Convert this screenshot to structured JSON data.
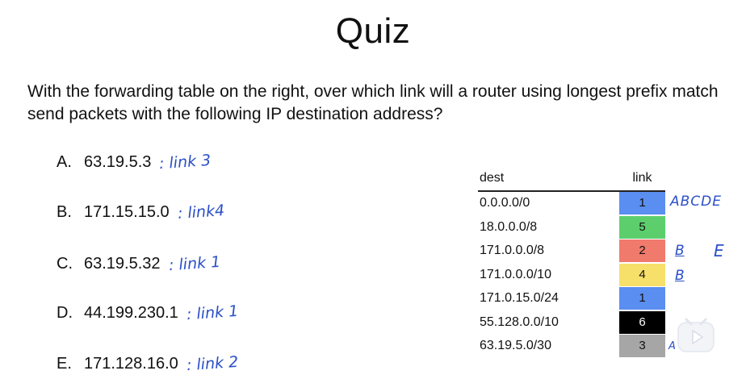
{
  "title": "Quiz",
  "question": "With the forwarding table on the right, over which link will a router using longest prefix match send packets with the following IP destination address?",
  "options": [
    {
      "letter": "A.",
      "address": "63.19.5.3",
      "answer": ": link 3"
    },
    {
      "letter": "B.",
      "address": "171.15.15.0",
      "answer": ": link4"
    },
    {
      "letter": "C.",
      "address": "63.19.5.32",
      "answer": ": link 1"
    },
    {
      "letter": "D.",
      "address": "44.199.230.1",
      "answer": ": link 1"
    },
    {
      "letter": "E.",
      "address": "171.128.16.0",
      "answer": ": link 2"
    }
  ],
  "table": {
    "headers": {
      "dest": "dest",
      "link": "link"
    },
    "rows": [
      {
        "dest": "0.0.0.0/0",
        "link": "1",
        "color": "#5a8ef0"
      },
      {
        "dest": "18.0.0.0/8",
        "link": "5",
        "color": "#5ccf6c"
      },
      {
        "dest": "171.0.0.0/8",
        "link": "2",
        "color": "#f07a6c"
      },
      {
        "dest": "171.0.0.0/10",
        "link": "4",
        "color": "#f7e06a"
      },
      {
        "dest": "171.0.15.0/24",
        "link": "1",
        "color": "#5a8ef0"
      },
      {
        "dest": "55.128.0.0/10",
        "link": "6",
        "color": "#000000"
      },
      {
        "dest": "63.19.5.0/30",
        "link": "3",
        "color": "#a6a6a6"
      }
    ]
  },
  "annotations": {
    "abcde": "ABCDE",
    "b1": "B",
    "e": "E",
    "b2": "B",
    "a": "A"
  },
  "logo_icon": "video-play-icon"
}
